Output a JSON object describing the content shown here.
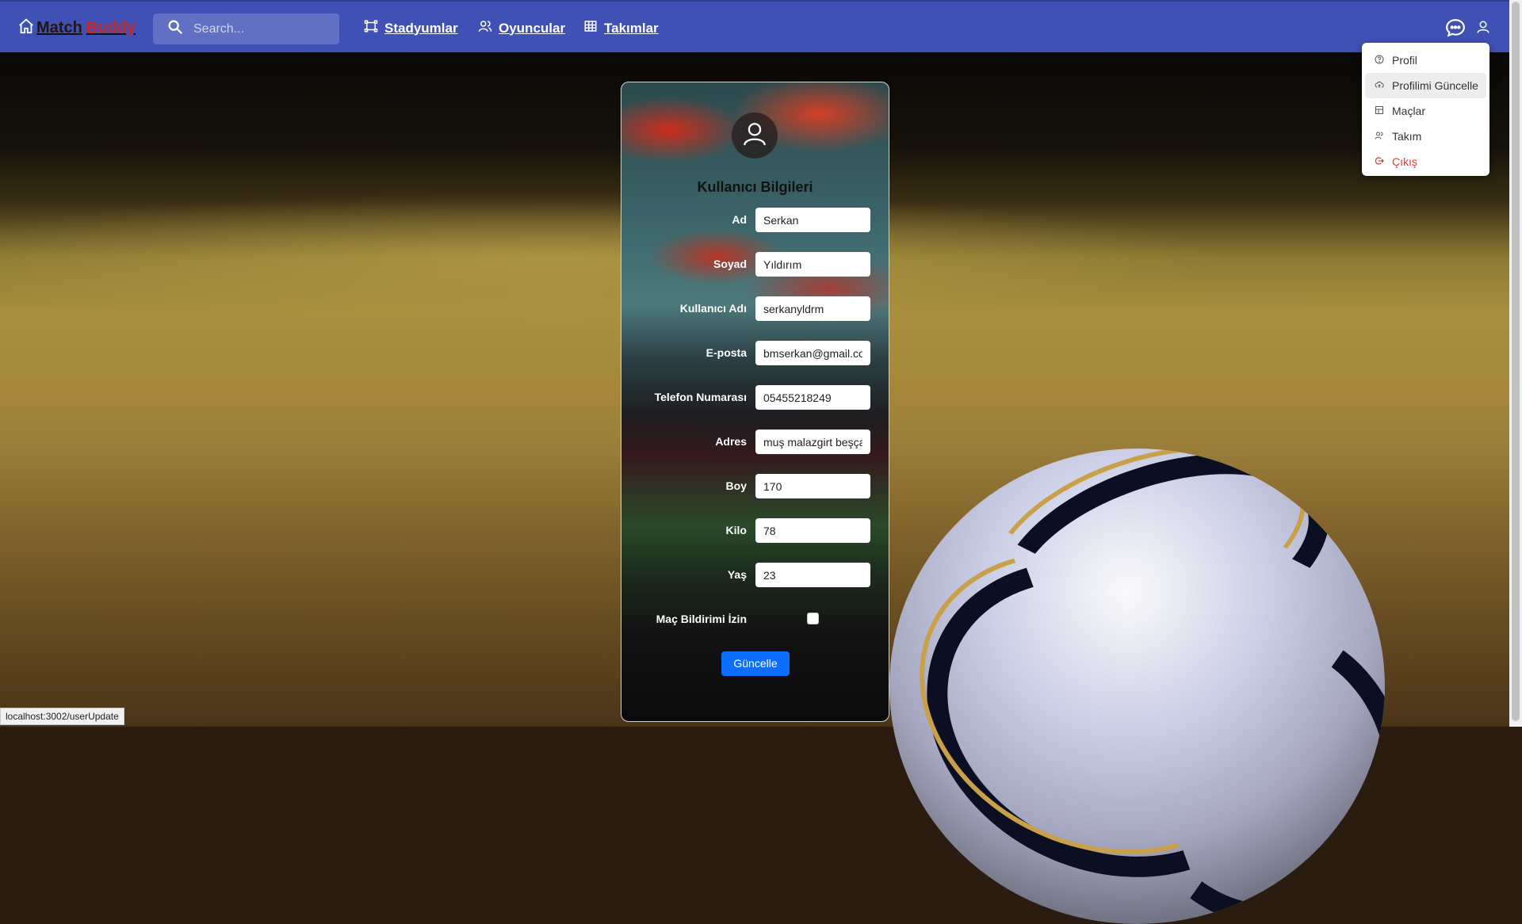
{
  "navbar": {
    "brand_part1": "Match",
    "brand_part2": "Buddy",
    "search_placeholder": "Search...",
    "links": [
      {
        "label": "Stadyumlar",
        "icon": "stadium-icon"
      },
      {
        "label": "Oyuncular",
        "icon": "players-icon"
      },
      {
        "label": "Takımlar",
        "icon": "table-icon"
      }
    ],
    "right_icons": [
      "chat-icon",
      "user-icon"
    ],
    "colors": {
      "background": "#3f51b5",
      "brand_part1": "#2a1406",
      "brand_part2": "#c62828"
    }
  },
  "user_menu": {
    "items": [
      {
        "label": "Profil",
        "icon": "help-circle-icon"
      },
      {
        "label": "Profilimi Güncelle",
        "icon": "cloud-upload-icon"
      },
      {
        "label": "Maçlar",
        "icon": "grid-icon"
      },
      {
        "label": "Takım",
        "icon": "team-icon"
      },
      {
        "label": "Çıkış",
        "icon": "logout-icon"
      }
    ],
    "logout_color": "#e53935"
  },
  "form": {
    "title": "Kullanıcı Bilgileri",
    "fields": [
      {
        "label": "Ad",
        "value": "Serkan"
      },
      {
        "label": "Soyad",
        "value": "Yıldırım"
      },
      {
        "label": "Kullanıcı Adı",
        "value": "serkanyldrm"
      },
      {
        "label": "E-posta",
        "value": "bmserkan@gmail.com"
      },
      {
        "label": "Telefon Numarası",
        "value": "05455218249"
      },
      {
        "label": "Adres",
        "value": "muş malazgirt beşçatak"
      },
      {
        "label": "Boy",
        "value": "170"
      },
      {
        "label": "Kilo",
        "value": "78"
      },
      {
        "label": "Yaş",
        "value": "23"
      }
    ],
    "notification_label": "Maç Bildirimi İzin",
    "notification_checked": false,
    "submit_label": "Güncelle",
    "submit_color": "#0d6efd"
  },
  "status_bar": {
    "url": "localhost:3002/userUpdate"
  }
}
